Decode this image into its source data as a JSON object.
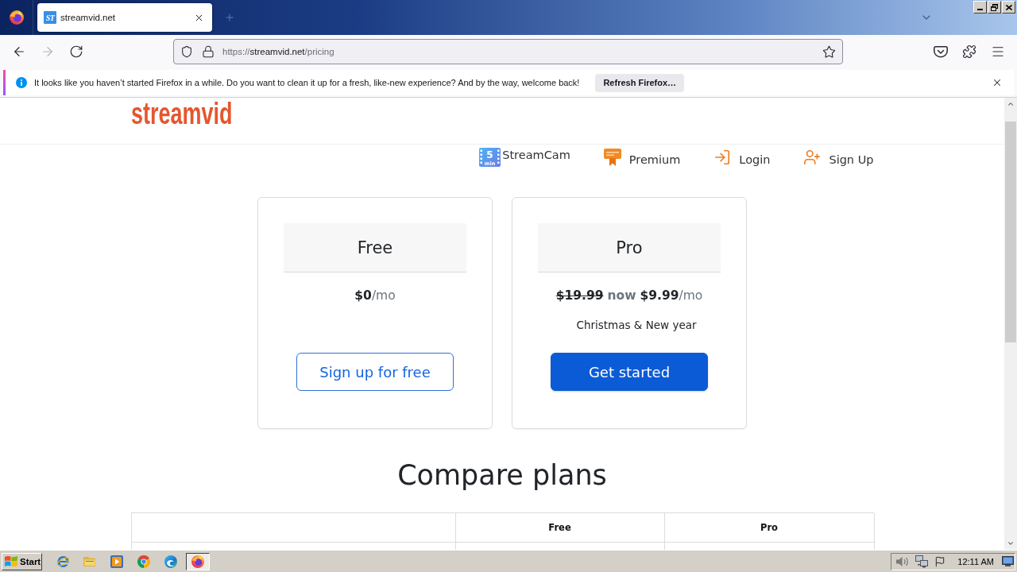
{
  "browser": {
    "tabs": [
      {
        "favicon_text": "ST",
        "title": "streamvid.net",
        "selected": true
      }
    ],
    "nav_buttons": [
      {
        "kind": "back",
        "disabled": false
      },
      {
        "kind": "forward",
        "disabled": true
      },
      {
        "kind": "reload",
        "disabled": false
      }
    ],
    "address_bar": {
      "scheme": "https://",
      "host": "streamvid.net",
      "path": "/pricing"
    },
    "notification": {
      "message": "It looks like you haven’t started Firefox in a while. Do you want to clean it up for a fresh, like-new experience? And by the way, welcome back!",
      "button": "Refresh Firefox…"
    }
  },
  "page": {
    "logo": "streamvid",
    "nav": [
      {
        "kind": "film",
        "label": "StreamCam",
        "badge": "5",
        "badge_caption": "min"
      },
      {
        "kind": "certificate",
        "label": "Premium"
      },
      {
        "kind": "login",
        "label": "Login"
      },
      {
        "kind": "user-add",
        "label": "Sign Up"
      }
    ],
    "plans": [
      {
        "name": "Free",
        "price": "$0",
        "period": "/mo",
        "button": {
          "kind": "outline",
          "label": "Sign up for free"
        }
      },
      {
        "name": "Pro",
        "old_price": "$19.99",
        "now": "now",
        "price": "$9.99",
        "period": "/mo",
        "note": "Christmas & New year",
        "button": {
          "kind": "primary",
          "label": "Get started"
        }
      }
    ],
    "compare": {
      "title": "Compare plans",
      "columns": [
        "Free",
        "Pro"
      ]
    }
  },
  "taskbar": {
    "start": "Start",
    "apps": [
      {
        "kind": "ie",
        "selected": false
      },
      {
        "kind": "folder",
        "selected": false
      },
      {
        "kind": "media",
        "selected": false
      },
      {
        "kind": "chrome",
        "selected": false
      },
      {
        "kind": "edge",
        "selected": false
      },
      {
        "kind": "firefox",
        "selected": true
      }
    ],
    "clock": "12:11 AM"
  }
}
